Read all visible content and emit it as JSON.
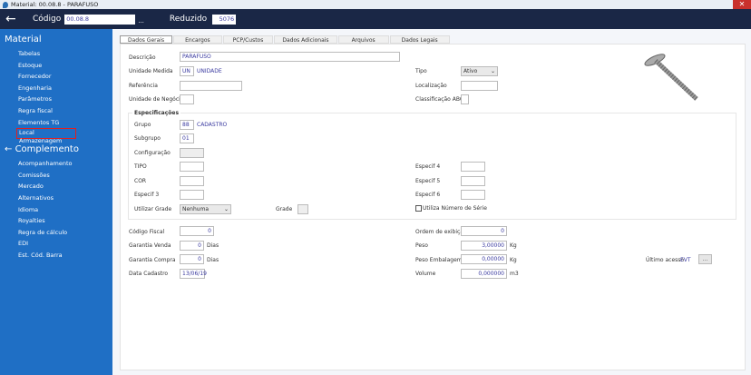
{
  "window": {
    "title": "Material: 00.08.8 - PARAFUSO",
    "close": "✕"
  },
  "header": {
    "codigo_label": "Código",
    "codigo": "00.08.8",
    "dots": "...",
    "reduzido_label": "Reduzido",
    "reduzido": "5076"
  },
  "sidebar": {
    "title": "Material",
    "items": [
      "Tabelas",
      "Estoque",
      "Fornecedor",
      "Engenharia",
      "Parâmetros",
      "Regra fiscal",
      "Elementos TG",
      "Local Armazenagem"
    ],
    "section": "Complemento",
    "items2": [
      "Acompanhamento",
      "Comissões",
      "Mercado",
      "Alternativos",
      "Idioma",
      "Royalties",
      "Regra de cálculo",
      "EDI",
      "Est. Cód. Barra"
    ]
  },
  "tabs": [
    "Dados Gerais",
    "Encargos",
    "PCP/Custos",
    "Dados Adicionais",
    "Arquivos",
    "Dados Legais"
  ],
  "form": {
    "descricao_label": "Descrição",
    "descricao": "PARAFUSO",
    "unidade_label": "Unidade Medida",
    "unidade": "UN",
    "unidade_desc": "UNIDADE",
    "referencia_label": "Referência",
    "unidade_negocio_label": "Unidade de Negócio",
    "tipo_label": "Tipo",
    "tipo": "Ativo",
    "localizacao_label": "Localização",
    "classificacao_label": "Classificação ABC",
    "spec_title": "Especificações",
    "grupo_label": "Grupo",
    "grupo": "88",
    "grupo_desc": "CADASTRO",
    "subgrupo_label": "Subgrupo",
    "subgrupo": "01",
    "configuracao_label": "Configuração",
    "tipo2_label": "TIPO",
    "cor_label": "COR",
    "especif3_label": "Especif 3",
    "especif4_label": "Especif 4",
    "especif5_label": "Especif 5",
    "especif6_label": "Especif 6",
    "utilizar_grade_label": "Utilizar Grade",
    "utilizar_grade": "Nenhuma",
    "grade_label": "Grade",
    "serie_label": "Utiliza Número de Série",
    "codigo_fiscal_label": "Código Fiscal",
    "codigo_fiscal": "0",
    "garantia_venda_label": "Garantia Venda",
    "garantia_venda": "0",
    "garantia_compra_label": "Garantia Compra",
    "garantia_compra": "0",
    "dias": "Dias",
    "data_cadastro_label": "Data Cadastro",
    "data_cadastro": "13/06/19",
    "ordem_label": "Ordem de exibição",
    "ordem": "0",
    "peso_label": "Peso",
    "peso": "3,00000",
    "kg": "Kg",
    "peso_emb_label": "Peso Embalagem",
    "peso_emb": "0,00000",
    "volume_label": "Volume",
    "volume": "0,000000",
    "m3": "m3",
    "ultimo_label": "Último acesso",
    "ultimo": "EVT",
    "ultimo_btn": "..."
  }
}
